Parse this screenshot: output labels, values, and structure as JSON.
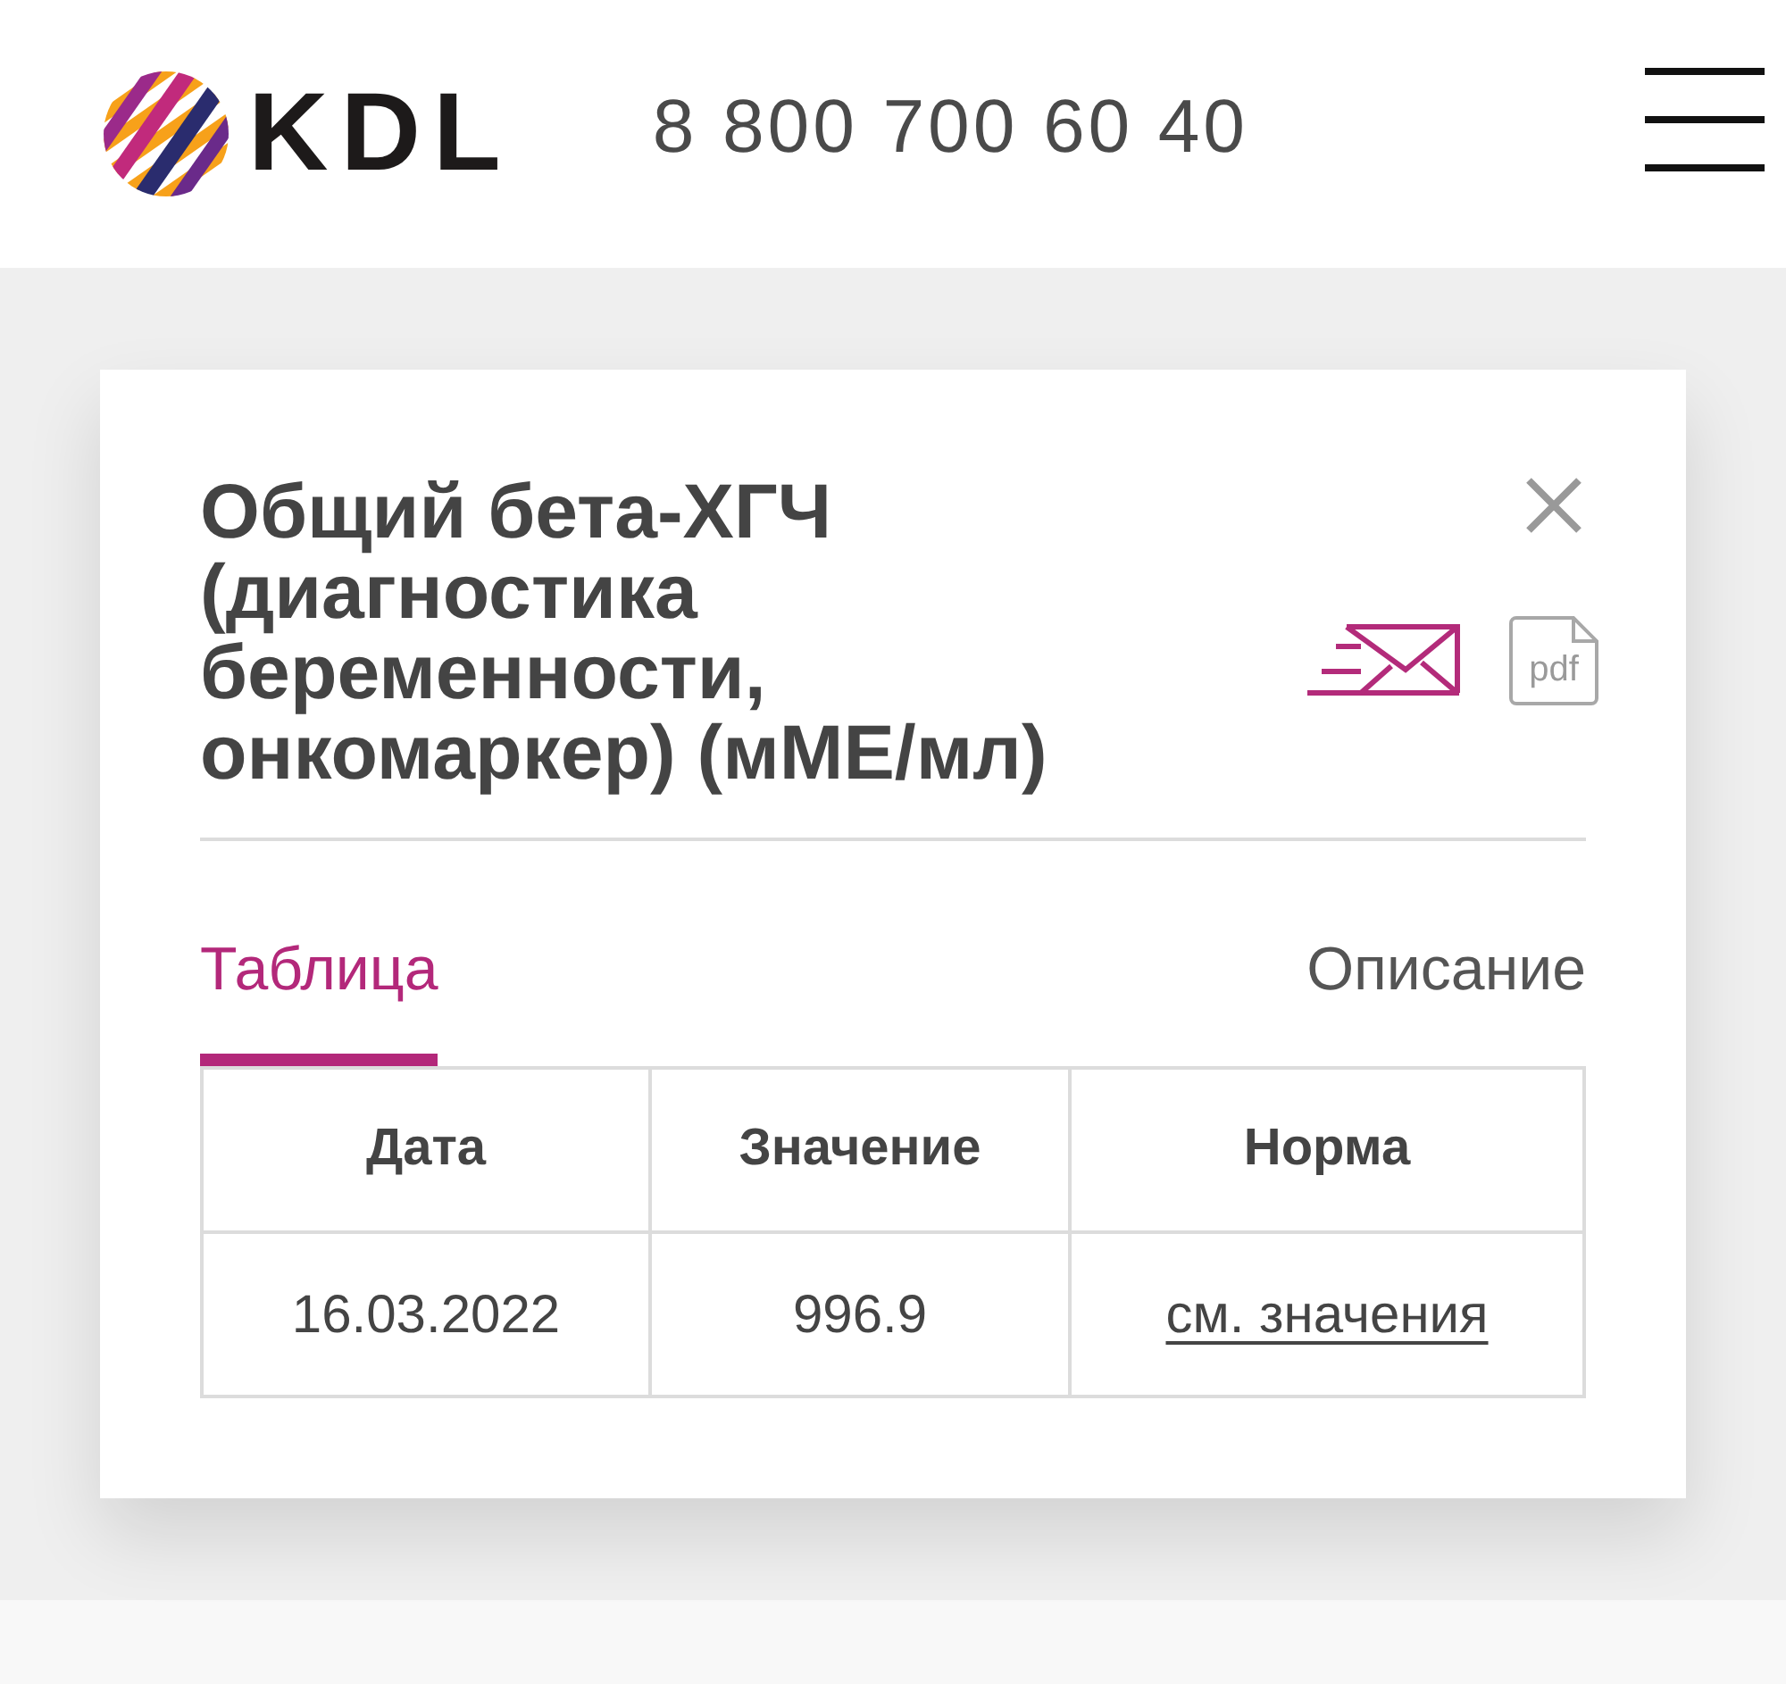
{
  "header": {
    "logo_text": "KDL",
    "phone": "8 800 700 60 40"
  },
  "card": {
    "title": "Общий бета-ХГЧ (диагностика беременности, онкомаркер) (мМЕ/мл)",
    "actions": [
      {
        "kind": "email"
      },
      {
        "kind": "pdf",
        "label": "pdf"
      }
    ]
  },
  "tabs": [
    {
      "label": "Таблица",
      "selected": true
    },
    {
      "label": "Описание",
      "selected": false
    }
  ],
  "table": {
    "columns": [
      "Дата",
      "Значение",
      "Норма"
    ],
    "rows": [
      {
        "cells": [
          {
            "kind": "text",
            "text": "16.03.2022"
          },
          {
            "kind": "text",
            "text": "996.9"
          },
          {
            "kind": "link",
            "text": "см. значения"
          }
        ]
      }
    ]
  }
}
